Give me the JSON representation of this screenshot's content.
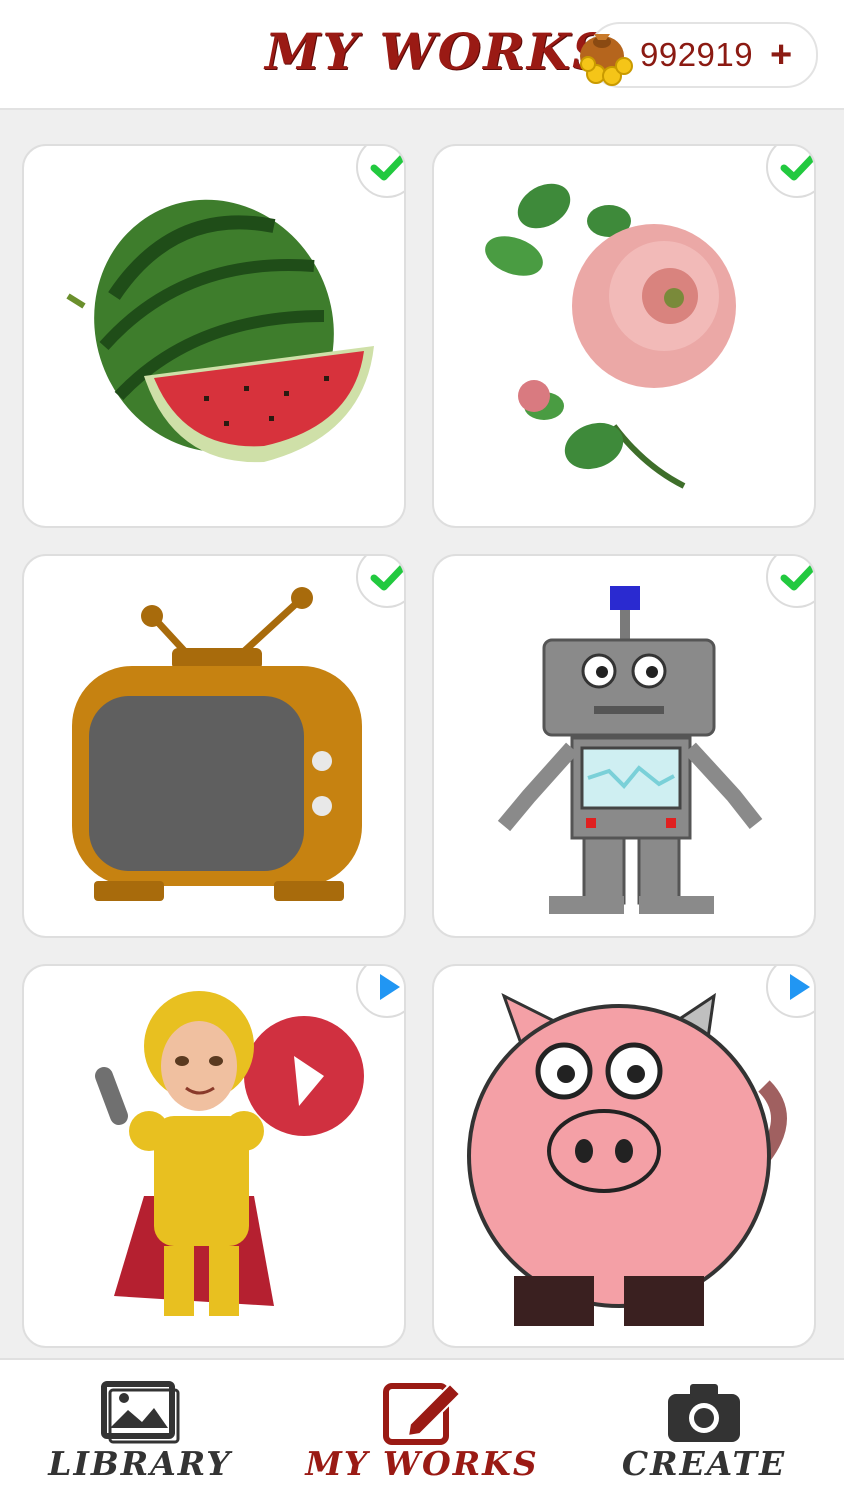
{
  "header": {
    "title": "MY WORKS",
    "coins": "992919",
    "add_symbol": "+",
    "coin_icon": "coin-bag-icon"
  },
  "works": [
    {
      "subject": "watermelon",
      "status": "completed",
      "status_icon": "check-icon"
    },
    {
      "subject": "rose",
      "status": "completed",
      "status_icon": "check-icon"
    },
    {
      "subject": "retro-tv",
      "status": "completed",
      "status_icon": "check-icon"
    },
    {
      "subject": "robot",
      "status": "completed",
      "status_icon": "check-icon"
    },
    {
      "subject": "knight",
      "status": "in-progress",
      "status_icon": "play-icon"
    },
    {
      "subject": "pig",
      "status": "in-progress",
      "status_icon": "play-icon"
    }
  ],
  "nav": {
    "library_label": "LIBRARY",
    "myworks_label": "MY WORKS",
    "create_label": "CREATE",
    "active_tab": "MY WORKS",
    "active_color": "#9a1a14",
    "inactive_color": "#333333"
  },
  "colors": {
    "brand": "#9a1a14",
    "check": "#22c93f",
    "play": "#2196f3"
  }
}
